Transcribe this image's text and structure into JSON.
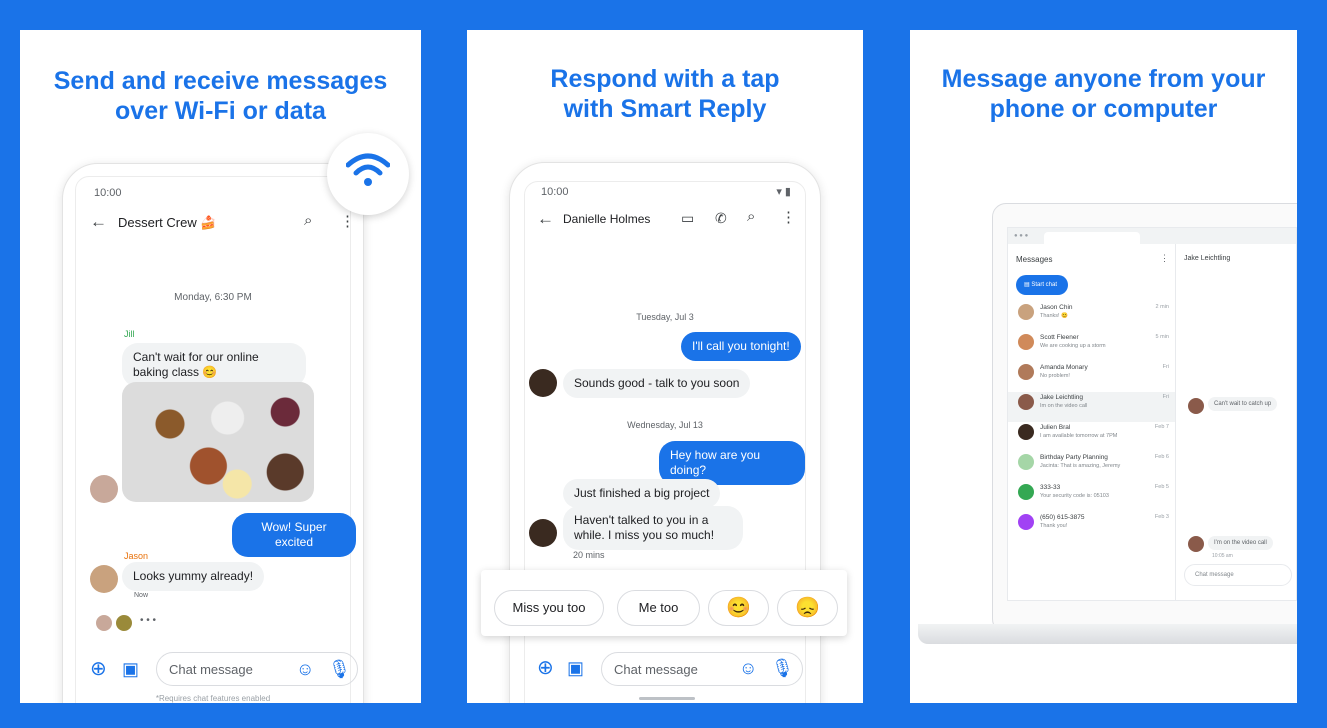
{
  "colors": {
    "brand": "#1a73e8",
    "bubble_in": "#f1f3f4",
    "bubble_out": "#1a73e8",
    "background": "#1a73e8"
  },
  "panel1": {
    "title_line1": "Send and receive messages",
    "title_line2": "over Wi-Fi or data",
    "status_time": "10:00",
    "contact": "Dessert Crew 🍰",
    "date_label": "Monday, 6:30 PM",
    "sender1": "Jill",
    "msg1": "Can't wait for our online baking class 😊",
    "out_msg": "Wow! Super excited",
    "sender2": "Jason",
    "msg2": "Looks yummy already!",
    "msg2_time": "Now",
    "typing": "• • •",
    "input_placeholder": "Chat message",
    "footnote": "*Requires chat features enabled",
    "icons": [
      "wifi-icon",
      "back-arrow-icon",
      "search-icon",
      "more-vert-icon",
      "add-circle-icon",
      "gallery-icon",
      "emoji-icon",
      "mic-icon"
    ]
  },
  "panel2": {
    "title_line1": "Respond with a tap",
    "title_line2": "with Smart Reply",
    "status_time": "10:00",
    "contact": "Danielle Holmes",
    "date1": "Tuesday, Jul 3",
    "out1": "I'll call you tonight!",
    "in1": "Sounds good - talk to you soon",
    "date2": "Wednesday, Jul 13",
    "out2": "Hey how are you doing?",
    "in2": "Just finished a big project",
    "in3": "Haven't talked to you in a while. I miss you so much!",
    "in3_time": "20 mins",
    "smart_replies": [
      "Miss you too",
      "Me too",
      "😊",
      "😞"
    ],
    "input_placeholder": "Chat message"
  },
  "panel3": {
    "title_line1": "Message anyone from your",
    "title_line2": "phone or computer",
    "app_title": "Messages",
    "start_chat": "Start chat",
    "conversations": [
      {
        "name": "Jason Chin",
        "preview": "Thanks! 😊",
        "time": "2 min",
        "color": "#c9a27e"
      },
      {
        "name": "Scott Fleener",
        "preview": "We are cooking up a storm",
        "time": "5 min",
        "color": "#d08a5a"
      },
      {
        "name": "Amanda Monary",
        "preview": "No problem!",
        "time": "Fri",
        "color": "#b07a5a"
      },
      {
        "name": "Jake Leichtling",
        "preview": "Im on the video call",
        "time": "Fri",
        "color": "#8a5a4a"
      },
      {
        "name": "Julien Bral",
        "preview": "I am available tomorrow at 7PM",
        "time": "Feb 7",
        "color": "#3a2a20"
      },
      {
        "name": "Birthday Party Planning",
        "preview": "Jacinta: That is amazing, Jeremy",
        "time": "Feb 6",
        "color": "#a5d6a7"
      },
      {
        "name": "333-33",
        "preview": "Your security code is: 05103",
        "time": "Feb 5",
        "color": "#34a853"
      },
      {
        "name": "(650) 615-3875",
        "preview": "Thank you!",
        "time": "Feb 3",
        "color": "#a142f4"
      }
    ],
    "active_contact": "Jake Leichtling",
    "msg1": "Can't wait to catch up",
    "msg2": "I'm on the video call",
    "msg2_time": "10:05 am",
    "input_placeholder": "Chat message"
  }
}
